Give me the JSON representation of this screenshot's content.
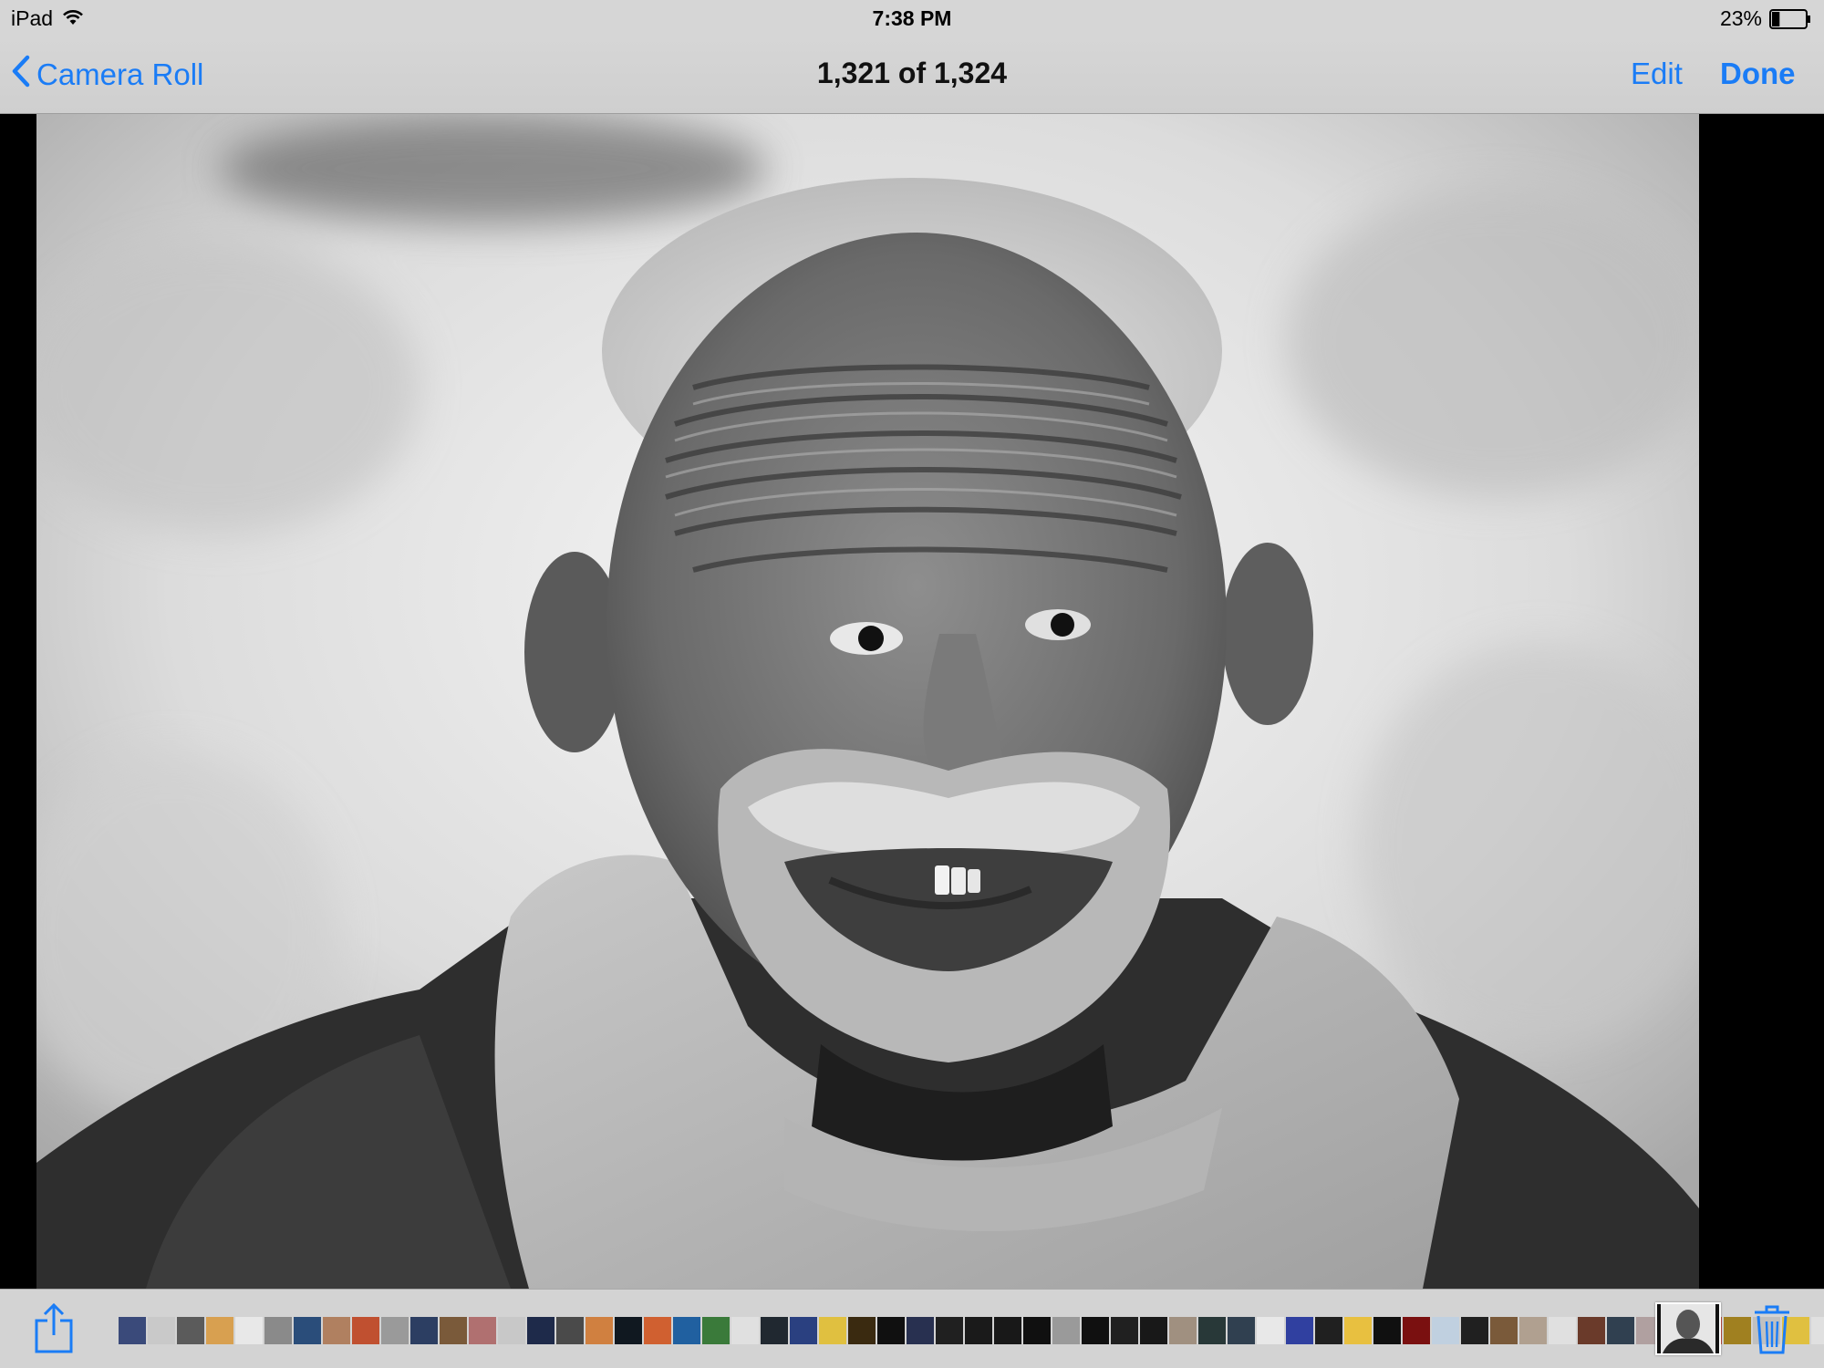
{
  "status_bar": {
    "device": "iPad",
    "time": "7:38 PM",
    "battery_percent": "23%",
    "battery_level": 0.23,
    "wifi_icon": "wifi-icon"
  },
  "nav_bar": {
    "back_label": "Camera Roll",
    "title": "1,321 of 1,324",
    "edit_label": "Edit",
    "done_label": "Done"
  },
  "photo": {
    "subject": "black-and-white portrait"
  },
  "toolbar": {
    "share_icon": "share-icon",
    "trash_icon": "trash-icon"
  },
  "filmstrip": {
    "thumbnail_colors": [
      "#3a4a7a",
      "#c9c9c9",
      "#5b5b5b",
      "#d8a050",
      "#e8e8e8",
      "#8a8a8a",
      "#2a4d7a",
      "#b08060",
      "#c05030",
      "#9a9a9a",
      "#2c3e62",
      "#7a5a3a",
      "#b07070",
      "#c8c8c8",
      "#1e2a4a",
      "#4a4a4a",
      "#d08040",
      "#101820",
      "#d06030",
      "#2060a0",
      "#3a7a3a",
      "#e0e0e0",
      "#202830",
      "#2a4080",
      "#e0c040",
      "#3a2a10",
      "#101010",
      "#283050",
      "#202020",
      "#1a1a1a",
      "#181818",
      "#101010",
      "#9a9a9a",
      "#101010",
      "#202020",
      "#181818",
      "#a09080",
      "#283838",
      "#304050",
      "#e8e8e8",
      "#3040a0",
      "#202020",
      "#e8c040",
      "#101010",
      "#7a1010",
      "#c0d0e0",
      "#202020",
      "#7a5a3a",
      "#b0a090",
      "#e0e0e0",
      "#6a3a2a",
      "#304050",
      "#b0a0a0",
      "#3a8a3a",
      "#c03020",
      "#a08020",
      "#c0c0c0",
      "#e0c040",
      "#e0e0e0",
      "#2a2a6a"
    ]
  }
}
